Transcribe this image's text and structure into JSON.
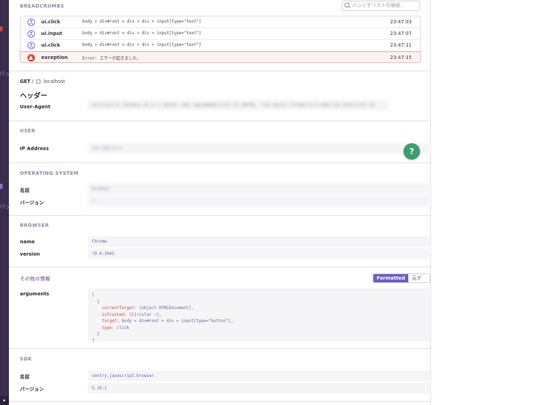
{
  "breadcrumbs": {
    "title": "BREADCRUMBS",
    "search_placeholder": "パンくずリストの検索...",
    "rows": [
      {
        "category": "ui.click",
        "message": "body > div#root > div > div > input[type=\"text\"]",
        "time": "23:47:03",
        "type": "user"
      },
      {
        "category": "ui.input",
        "message": "body > div#root > div > div > input[type=\"text\"]",
        "time": "23:47:07",
        "type": "user"
      },
      {
        "category": "ui.click",
        "message": "body > div#root > div > div > input[type=\"text\"]",
        "time": "23:47:11",
        "type": "user"
      },
      {
        "category": "exception",
        "message": "Error: エラーが起きました。",
        "time": "23:47:15",
        "type": "error"
      }
    ]
  },
  "request": {
    "method": "GET",
    "separator": "/",
    "host": "localhost",
    "headers_title": "ヘッダー",
    "user_agent_key": "User-Agent",
    "user_agent_value": "Mozilla/5.0 (Windows NT 6.1; Win64; x64) AppleWebKit/537.36 (KHTML, like Gecko) Chrome/79.0.3945.130 Safari/537.36"
  },
  "user": {
    "title": "USER",
    "ip_key": "IP Address",
    "ip_value": "223.108.23.4"
  },
  "os": {
    "title": "OPERATING SYSTEM",
    "name_key": "名前",
    "name_value": "Windows",
    "version_key": "バージョン",
    "version_value": "7"
  },
  "browser": {
    "title": "BROWSER",
    "name_key": "name",
    "name_value": "Chrome",
    "version_key": "version",
    "version_value": "79.0.3945"
  },
  "extra": {
    "title": "その他の情報",
    "formatted_label": "Formatted",
    "raw_label": "元データ",
    "arguments_key": "arguments",
    "code": {
      "open": "[",
      "obj_open": "  {",
      "l1k": "currentTarget",
      "l1v": "[object HTMLDocument],",
      "l2k": "isTrusted",
      "l2v": "[Circular ~],",
      "l3k": "target",
      "l3v": "body > div#root > div > input[type=\"button\"],",
      "l4k": "type",
      "l4v": "click",
      "obj_close": "  }",
      "close": "]"
    }
  },
  "sdk": {
    "title": "SDK",
    "name_key": "名前",
    "name_value": "sentry.javascript.browser",
    "version_key": "バージョン",
    "version_value": "5.10.1"
  },
  "help_label": "?",
  "sidebar": {
    "label_1": "パッ",
    "label_2": "パッ",
    "collapse_icon": "▸"
  },
  "colors": {
    "accent": "#6c5fc7",
    "error": "#e04b3a",
    "help": "#3c9d6f",
    "sidebar": "#3a2d4d"
  }
}
